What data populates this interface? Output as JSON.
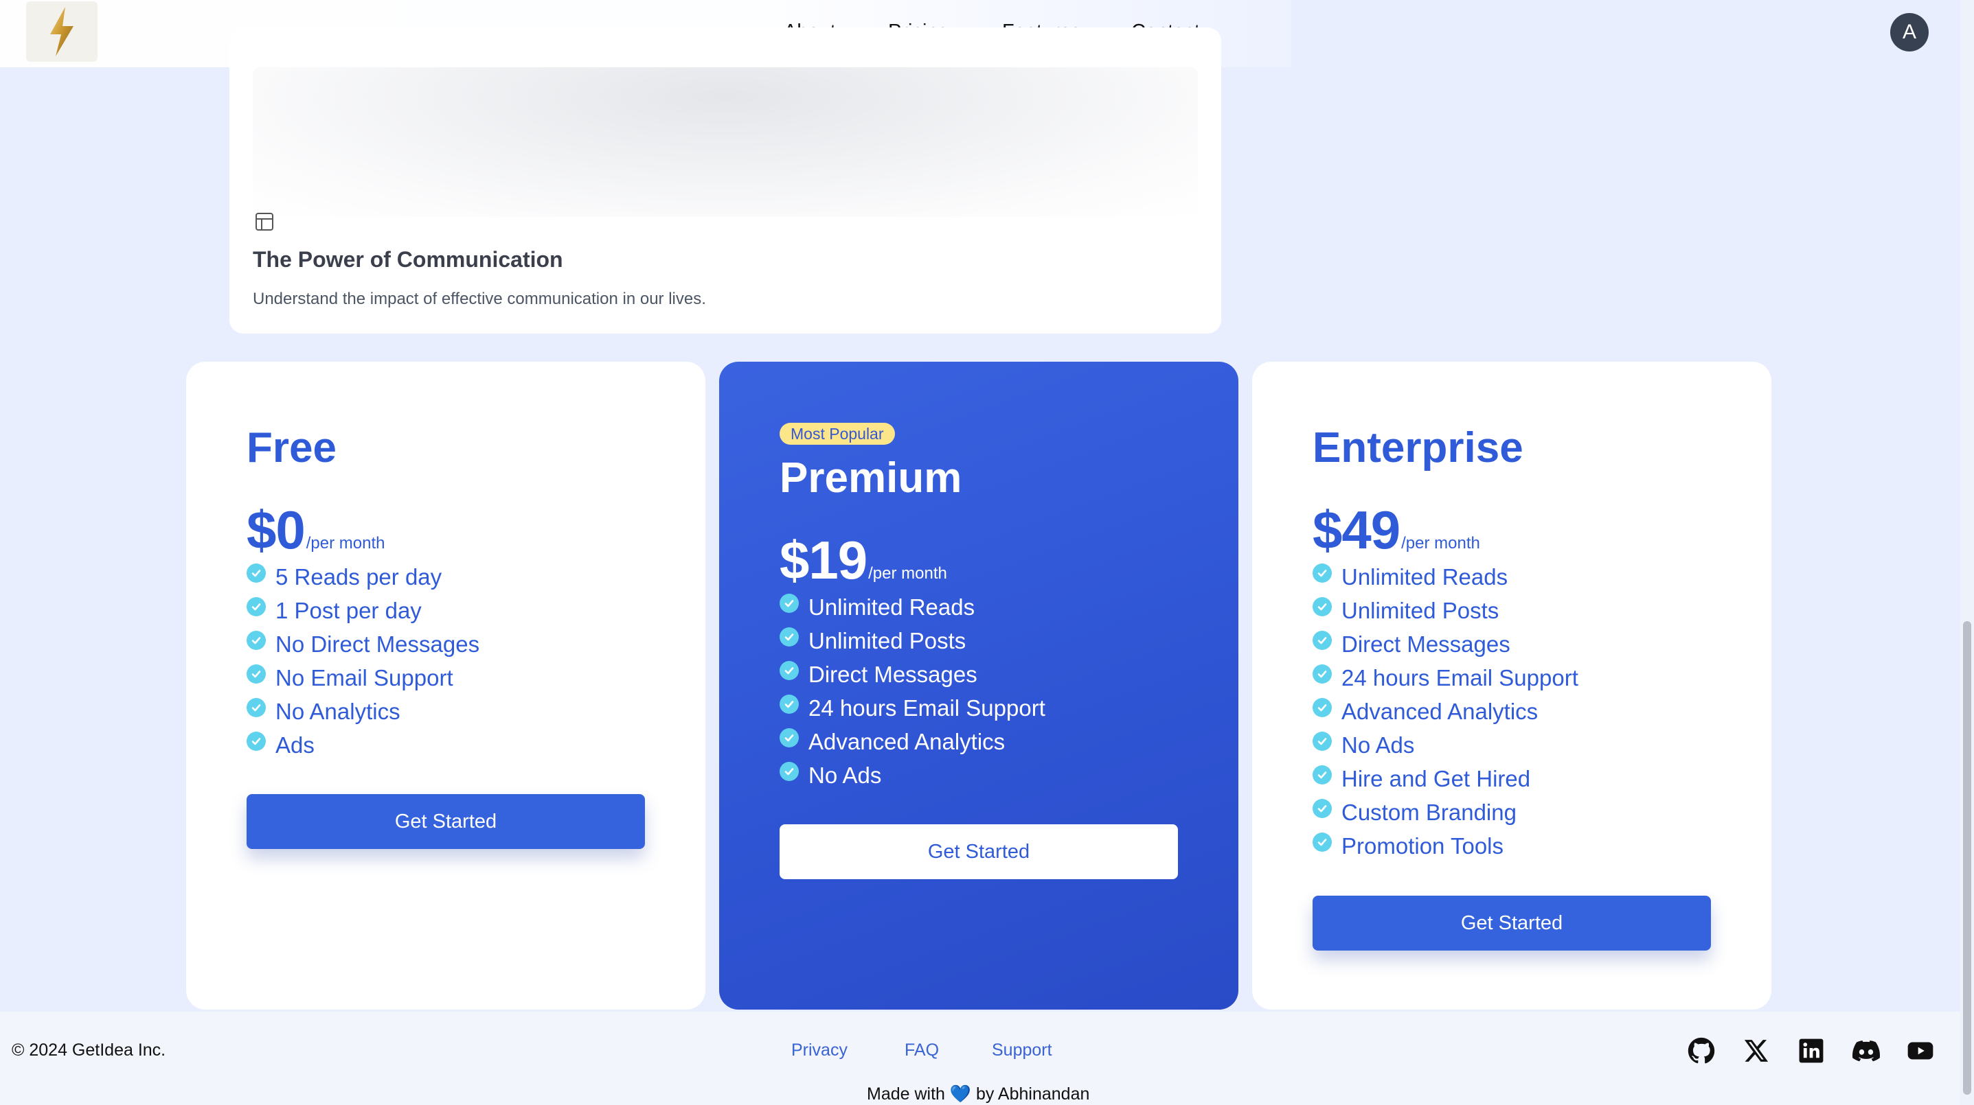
{
  "nav": {
    "items": [
      "About",
      "Pricing",
      "Features",
      "Contact"
    ],
    "avatar_initial": "A"
  },
  "article": {
    "title": "The Power of Communication",
    "description": "Understand the impact of effective communication in our lives."
  },
  "plans": [
    {
      "name": "Free",
      "price": "$0",
      "period": "/per month",
      "features": [
        "5 Reads per day",
        "1 Post per day",
        "No Direct Messages",
        "No Email Support",
        "No Analytics",
        "Ads"
      ],
      "cta": "Get Started"
    },
    {
      "badge": "Most Popular",
      "name": "Premium",
      "price": "$19",
      "period": "/per month",
      "features": [
        "Unlimited Reads",
        "Unlimited Posts",
        "Direct Messages",
        "24 hours Email Support",
        "Advanced Analytics",
        "No Ads"
      ],
      "cta": "Get Started"
    },
    {
      "name": "Enterprise",
      "price": "$49",
      "period": "/per month",
      "features": [
        "Unlimited Reads",
        "Unlimited Posts",
        "Direct Messages",
        "24 hours Email Support",
        "Advanced Analytics",
        "No Ads",
        "Hire and Get Hired",
        "Custom Branding",
        "Promotion Tools"
      ],
      "cta": "Get Started"
    }
  ],
  "footer": {
    "copyright": "© 2024 GetIdea Inc.",
    "links": [
      "Privacy",
      "FAQ",
      "Support"
    ],
    "made_with": "Made with 💙 by Abhinandan",
    "social_icons": [
      "github-icon",
      "x-icon",
      "linkedin-icon",
      "discord-icon",
      "youtube-icon"
    ]
  },
  "colors": {
    "accent": "#2f5bd8",
    "premium_bg": "#3a63e0",
    "check": "#5fd3ee",
    "badge_bg": "#fde68a",
    "page_bg": "#e8eefe"
  }
}
